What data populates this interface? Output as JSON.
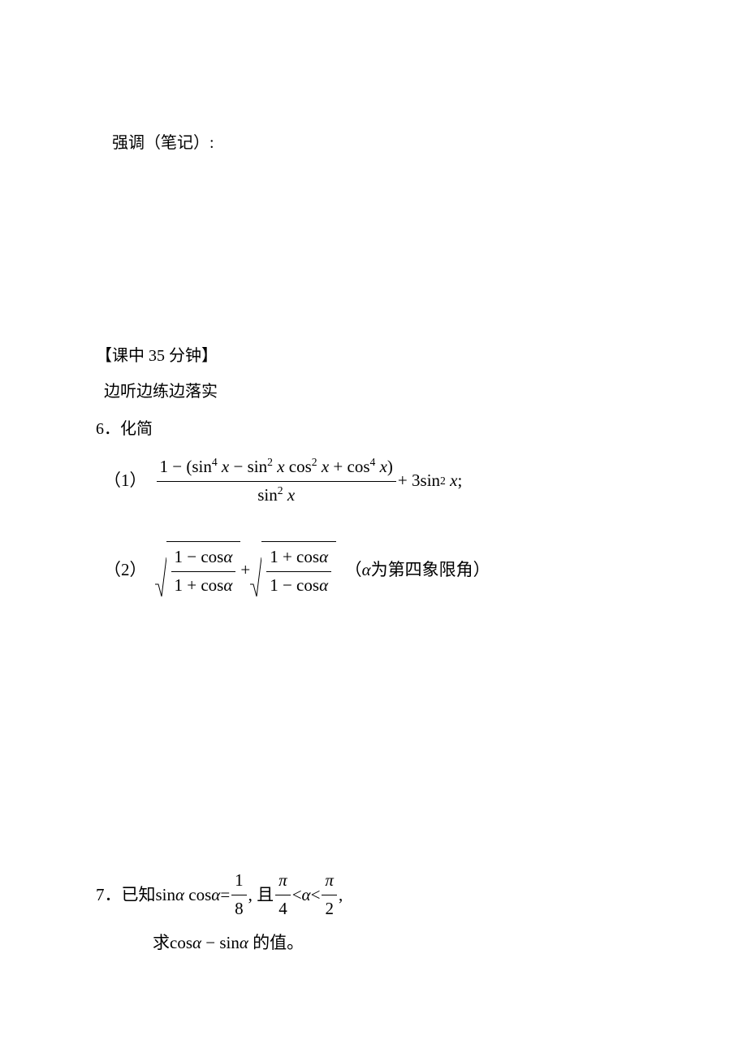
{
  "notes_label": "强调（笔记）:",
  "section_header": "【课中 35 分钟】",
  "subtitle": "边听边练边落实",
  "q6": {
    "num": "6．",
    "title": "化简",
    "p1_label": "（1）",
    "p1_numer_a": "1 − (sin",
    "p1_numer_b": " − sin",
    "p1_numer_c": " cos",
    "p1_numer_d": " + cos",
    "p1_numer_e": ")",
    "p1_denom_a": "sin",
    "p1_after_a": " + 3sin",
    "p1_after_b": " ;",
    "p2_label": "（2）",
    "p2_sq1_num": "1 − cos",
    "p2_sq1_den": "1 + cos",
    "p2_plus": " + ",
    "p2_sq2_num": "1 + cos",
    "p2_sq2_den": "1 − cos",
    "p2_tail_a": "（",
    "p2_tail_b": " 为第四象限角）"
  },
  "q7": {
    "num": "7．",
    "pre": "已知",
    "sin": "sin",
    "cos": "cos",
    "eq": " = ",
    "frac1_num": "1",
    "frac1_den": "8",
    "comma_and": ", 且",
    "pi": "π",
    "four": "4",
    "two": "2",
    "lt": " < ",
    "tail": " ,",
    "line2_a": "求",
    "line2_b": " − ",
    "line2_c": " 的值。"
  },
  "vars": {
    "x": "x",
    "alpha": "α"
  },
  "exp": {
    "2": "2",
    "4": "4"
  }
}
